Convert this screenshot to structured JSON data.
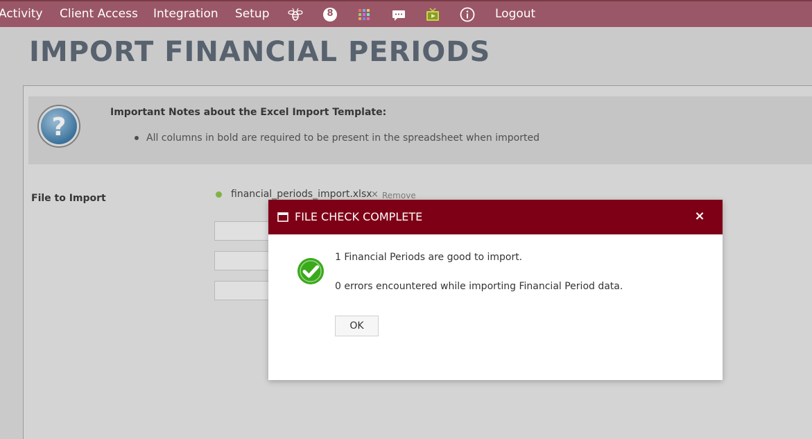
{
  "nav": {
    "items": [
      "Activity",
      "Client Access",
      "Integration",
      "Setup"
    ],
    "badge_number": "8",
    "logout": "Logout",
    "icons": [
      "bee-icon",
      "badge-8-icon",
      "apps-grid-icon",
      "chat-icon",
      "tv-icon",
      "info-icon"
    ]
  },
  "page": {
    "title": "IMPORT FINANCIAL PERIODS"
  },
  "notes": {
    "title": "Important Notes about the Excel Import Template:",
    "bullets": [
      "All columns in bold are required to be present in the spreadsheet when imported"
    ]
  },
  "file": {
    "label": "File to Import",
    "name": "financial_periods_import.xlsx",
    "remove_symbol": "×",
    "remove": "Remove",
    "status_color": "#8bc34a"
  },
  "dialog": {
    "title": "FILE CHECK COMPLETE",
    "close_symbol": "×",
    "message1": "1 Financial Periods are good to import.",
    "message2": "0 errors encountered while importing Financial Period data.",
    "ok_label": "OK",
    "header_color": "#7e0016",
    "success_color": "#3aaa1a"
  },
  "colors": {
    "nav_bg": "#9a5767",
    "title_color": "#5f6b78"
  }
}
